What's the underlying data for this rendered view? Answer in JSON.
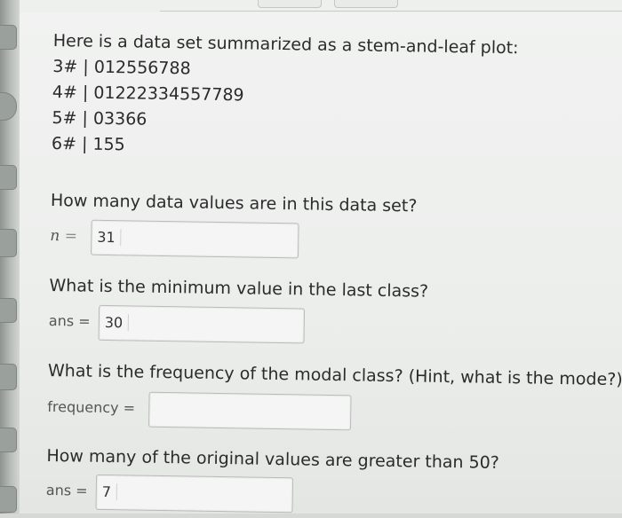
{
  "stem_leaf": {
    "intro": "Here is a data set summarized as a stem-and-leaf plot:",
    "rows": [
      "3# | 012556788",
      "4# | 01222334557789",
      "5# | 03366",
      "6# | 155"
    ]
  },
  "questions": [
    {
      "text": "How many data values are in this data set?",
      "label": "n",
      "equals": "=",
      "value": "31"
    },
    {
      "text": "What is the minimum value in the last class?",
      "label": "ans =",
      "value": "30"
    },
    {
      "text": "What is the frequency of the modal class? (Hint, what is the mode?)",
      "label": "frequency =",
      "value": ""
    },
    {
      "text": "How many of the original values are greater than 50?",
      "label": "ans =",
      "value": "7"
    }
  ]
}
